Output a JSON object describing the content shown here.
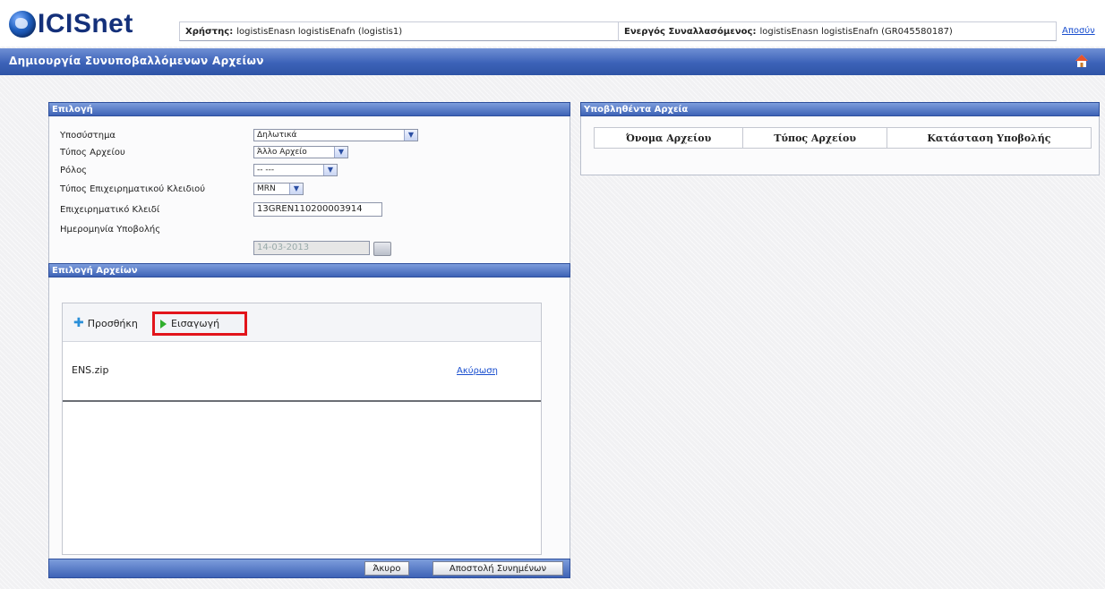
{
  "header": {
    "logo_text": "ICISnet",
    "user_label": "Χρήστης:",
    "user_value": "logistisEnasn logistisEnafn (logistis1)",
    "active_label": "Ενεργός Συναλλασόμενος:",
    "active_value": "logistisEnasn logistisEnafn (GR045580187)",
    "logout_link": "Αποσύν"
  },
  "titlebar": {
    "title": "Δημιουργία Συνυποβαλλόμενων Αρχείων"
  },
  "selection_panel": {
    "title": "Επιλογή",
    "fields": [
      {
        "label": "Υποσύστημα",
        "value": "Δηλωτικά"
      },
      {
        "label": "Τύπος Αρχείου",
        "value": "Άλλο Αρχείο"
      },
      {
        "label": "Ρόλος",
        "value": "-- ---"
      },
      {
        "label": "Τύπος Επιχειρηματικού Κλειδιού",
        "value": "MRN"
      },
      {
        "label": "Επιχειρηματικό Κλειδί",
        "value": "13GREN110200003914"
      },
      {
        "label": "Ημερομηνία Υποβολής",
        "value": "14-03-2013"
      }
    ]
  },
  "files_panel": {
    "title": "Επιλογή Αρχείων",
    "add_label": "Προσθήκη",
    "import_label": "Εισαγωγή",
    "file_name": "ENS.zip",
    "cancel_link": "Ακύρωση"
  },
  "footer_buttons": {
    "cancel": "Άκυρο",
    "send": "Αποστολή Συνημένων"
  },
  "submitted_panel": {
    "title": "Υποβληθέντα Αρχεία",
    "columns": [
      "Όνομα Αρχείου",
      "Τύπος Αρχείου",
      "Κατάσταση Υποβολής"
    ]
  },
  "colors": {
    "highlight": "#e2141b",
    "bar_blue": "#3e63b6",
    "link": "#1a4fcf"
  }
}
